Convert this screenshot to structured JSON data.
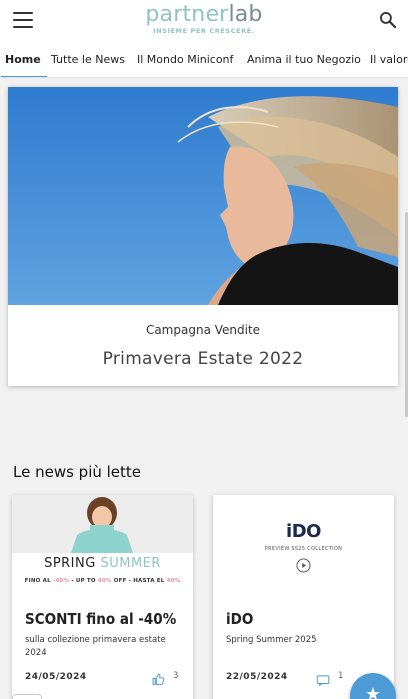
{
  "header": {
    "logo_main_a": "partner",
    "logo_main_b": "lab",
    "logo_tagline": "INSIEME PER CRESCERE."
  },
  "nav": {
    "tabs": [
      {
        "label": "Home",
        "active": true
      },
      {
        "label": "Tutte le News",
        "active": false
      },
      {
        "label": "Il Mondo Miniconf",
        "active": false
      },
      {
        "label": "Anima il tuo Negozio",
        "active": false
      },
      {
        "label": "Il valore",
        "active": false
      }
    ]
  },
  "hero": {
    "subtitle": "Campagna Vendite",
    "title": "Primavera Estate 2022"
  },
  "section": {
    "title": "Le news più lette"
  },
  "news": [
    {
      "promo_title_a": "SPRING",
      "promo_title_b": "SUMMER",
      "promo_line_a": "FINO AL ",
      "promo_line_b": "-40%",
      "promo_line_c": " - UP TO ",
      "promo_line_d": "40%",
      "promo_line_e": " OFF - HASTA EL ",
      "promo_line_f": "40%",
      "title": "SCONTI fino al -40%",
      "description": "sulla collezione primavera estate 2024",
      "date": "24/05/2024",
      "likes": "3"
    },
    {
      "logo_text": "iDO",
      "logo_sub": "PREVIEW SS25 COLLECTION",
      "title": "iDO",
      "description": "Spring Summer 2025",
      "date": "22/05/2024",
      "comments": "1"
    }
  ],
  "colors": {
    "accent": "#4d9bd6",
    "logo_teal": "#8fc5c1",
    "logo_gray": "#7b8a9a",
    "sky": "#3c86d0"
  }
}
